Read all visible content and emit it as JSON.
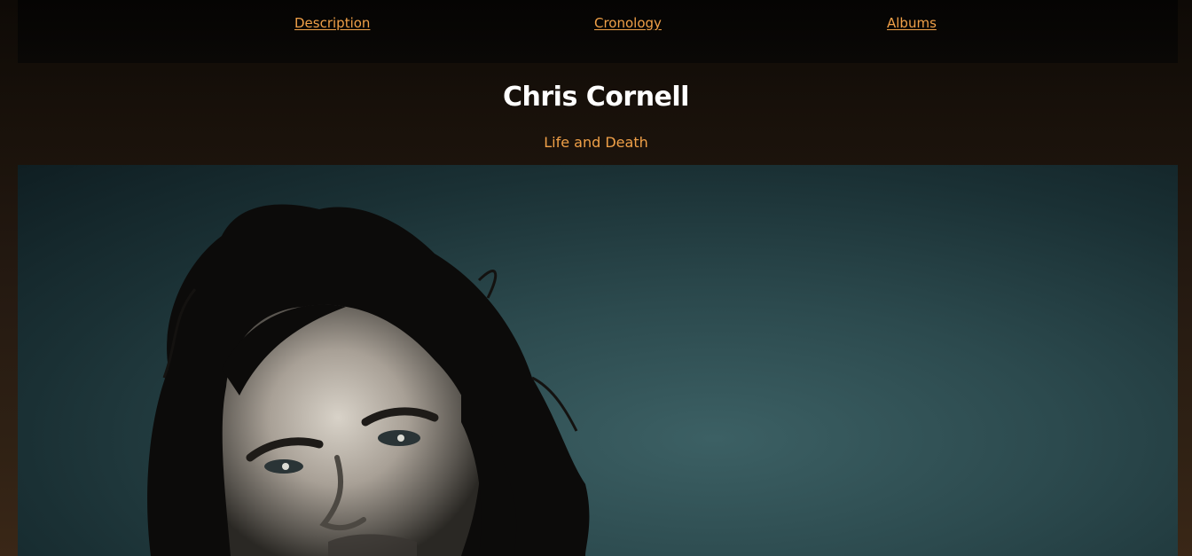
{
  "nav": {
    "items": [
      {
        "label": "Description"
      },
      {
        "label": "Cronology"
      },
      {
        "label": "Albums"
      }
    ]
  },
  "header": {
    "title": "Chris Cornell",
    "subtitle": "Life and Death"
  },
  "colors": {
    "accent": "#f0a048",
    "title": "#ffffff",
    "nav_background": "#060504",
    "photo_background": "#2c4a4e"
  }
}
